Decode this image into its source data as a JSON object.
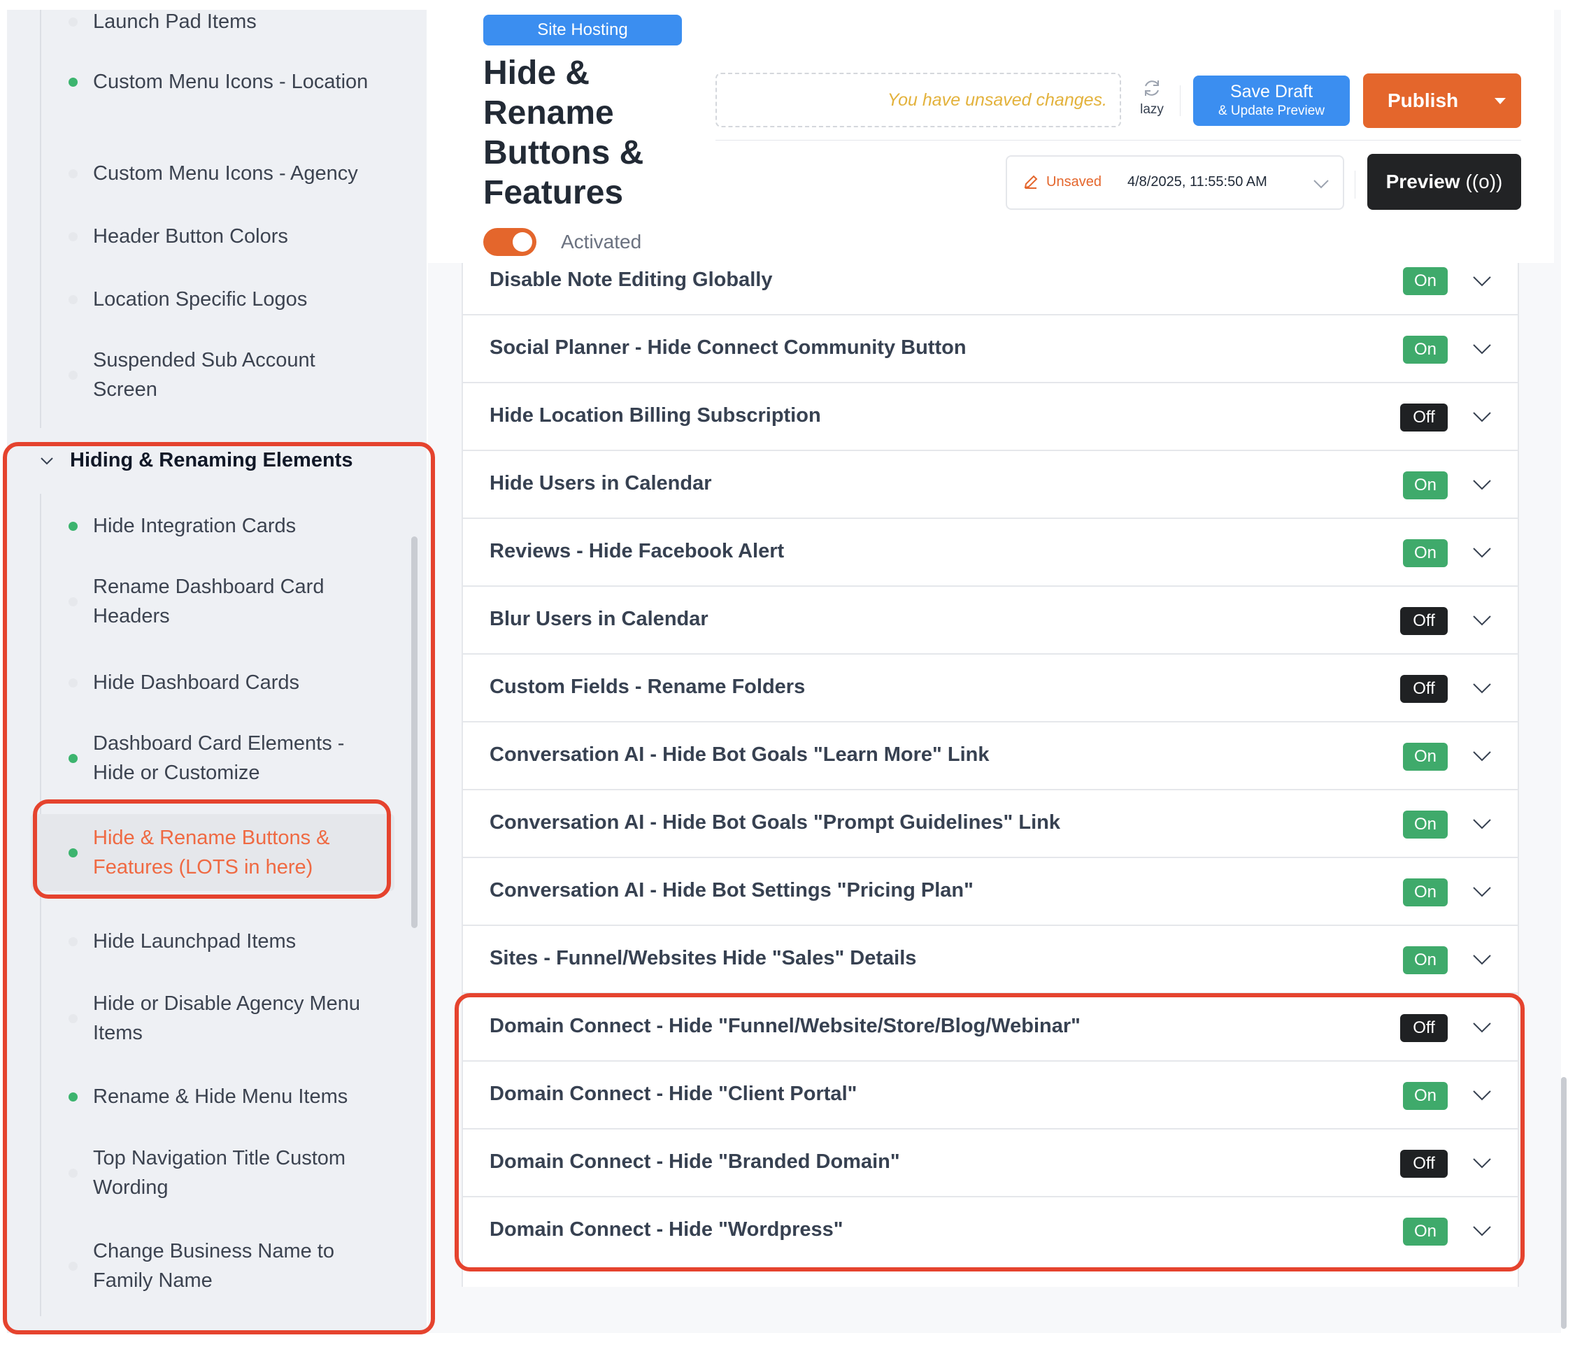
{
  "sidebar": {
    "items_top": [
      {
        "label": "Launch Pad Items",
        "dot": "none"
      },
      {
        "label": "Custom Menu Icons - Location",
        "dot": "green"
      },
      {
        "label": "Custom Menu Icons - Agency",
        "dot": "none"
      },
      {
        "label": "Header Button Colors",
        "dot": "none"
      },
      {
        "label": "Location Specific Logos",
        "dot": "none"
      },
      {
        "label": "Suspended Sub Account Screen",
        "dot": "none"
      }
    ],
    "section": {
      "label": "Hiding & Renaming Elements",
      "expanded": true
    },
    "items": [
      {
        "label": "Hide Integration Cards",
        "dot": "green"
      },
      {
        "label": "Rename Dashboard Card Headers",
        "dot": "none"
      },
      {
        "label": "Hide Dashboard Cards",
        "dot": "none"
      },
      {
        "label": "Dashboard Card Elements - Hide or Customize",
        "dot": "green"
      },
      {
        "label": "Hide & Rename Buttons & Features (LOTS in here)",
        "dot": "green",
        "active": true
      },
      {
        "label": "Hide Launchpad Items",
        "dot": "none"
      },
      {
        "label": "Hide or Disable Agency Menu Items",
        "dot": "none"
      },
      {
        "label": "Rename & Hide Menu Items",
        "dot": "green"
      },
      {
        "label": "Top Navigation Title Custom Wording",
        "dot": "none"
      },
      {
        "label": "Change Business Name to Family Name",
        "dot": "none"
      }
    ]
  },
  "header": {
    "tag": "Site Hosting",
    "title": "Hide & Rename Buttons & Features",
    "activated_label": "Activated",
    "activated": true,
    "unsaved_message": "You have unsaved changes.",
    "lazy_label": "lazy",
    "save_draft_label": "Save Draft",
    "save_draft_sub": "& Update Preview",
    "publish_label": "Publish",
    "version_status": "Unsaved",
    "version_timestamp": "4/8/2025, 11:55:50 AM",
    "preview_label": "Preview",
    "preview_icon": "((o))"
  },
  "features": [
    {
      "label": "Disable Note Editing Globally",
      "state": "On"
    },
    {
      "label": "Social Planner - Hide Connect Community Button",
      "state": "On"
    },
    {
      "label": "Hide Location Billing Subscription",
      "state": "Off"
    },
    {
      "label": "Hide Users in Calendar",
      "state": "On"
    },
    {
      "label": "Reviews - Hide Facebook Alert",
      "state": "On"
    },
    {
      "label": "Blur Users in Calendar",
      "state": "Off"
    },
    {
      "label": "Custom Fields - Rename Folders",
      "state": "Off"
    },
    {
      "label": "Conversation AI - Hide Bot Goals \"Learn More\" Link",
      "state": "On"
    },
    {
      "label": "Conversation AI - Hide Bot Goals \"Prompt Guidelines\" Link",
      "state": "On"
    },
    {
      "label": "Conversation AI - Hide Bot Settings \"Pricing Plan\"",
      "state": "On"
    },
    {
      "label": "Sites - Funnel/Websites Hide \"Sales\" Details",
      "state": "On"
    },
    {
      "label": "Domain Connect - Hide \"Funnel/Website/Store/Blog/Webinar\"",
      "state": "Off"
    },
    {
      "label": "Domain Connect - Hide \"Client Portal\"",
      "state": "On"
    },
    {
      "label": "Domain Connect - Hide \"Branded Domain\"",
      "state": "Off"
    },
    {
      "label": "Domain Connect - Hide \"Wordpress\"",
      "state": "On"
    }
  ],
  "colors": {
    "accent_orange": "#e4662c",
    "primary_blue": "#3b8ef0",
    "on_green": "#3faa6b",
    "off_black": "#1f2123",
    "highlight_red": "#e5432e",
    "active_item": "#ef6a43"
  }
}
